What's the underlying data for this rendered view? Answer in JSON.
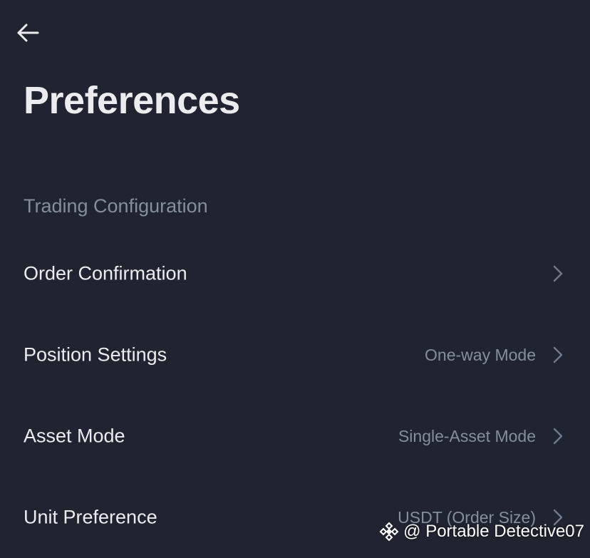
{
  "header": {
    "back_icon": "arrow-left-icon",
    "title": "Preferences"
  },
  "section": {
    "title": "Trading Configuration"
  },
  "settings": [
    {
      "label": "Order Confirmation",
      "value": "",
      "icon": "chevron-right-icon"
    },
    {
      "label": "Position Settings",
      "value": "One-way Mode",
      "icon": "chevron-right-icon"
    },
    {
      "label": "Asset Mode",
      "value": "Single-Asset Mode",
      "icon": "chevron-right-icon"
    },
    {
      "label": "Unit Preference",
      "value": "USDT (Order Size)",
      "icon": "chevron-right-icon"
    }
  ],
  "watermark": {
    "text": "@ Portable Detective07",
    "logo": "binance-logo-icon"
  },
  "colors": {
    "background": "#1f2430",
    "primary_text": "#eaecef",
    "secondary_text": "#848e9c"
  }
}
